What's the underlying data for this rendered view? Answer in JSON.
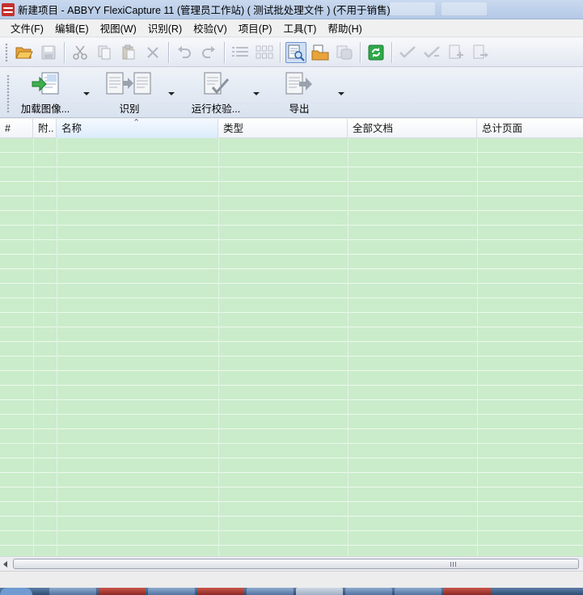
{
  "window": {
    "title": "新建项目 - ABBYY FlexiCapture 11 (管理员工作站) ( 测试批处理文件 ) (不用于销售)"
  },
  "menu": [
    {
      "name": "menu-file",
      "label": "文件(F)"
    },
    {
      "name": "menu-edit",
      "label": "编辑(E)"
    },
    {
      "name": "menu-view",
      "label": "视图(W)"
    },
    {
      "name": "menu-recognize",
      "label": "识别(R)"
    },
    {
      "name": "menu-verify",
      "label": "校验(V)"
    },
    {
      "name": "menu-project",
      "label": "项目(P)"
    },
    {
      "name": "menu-tools",
      "label": "工具(T)"
    },
    {
      "name": "menu-help",
      "label": "帮助(H)"
    }
  ],
  "big_toolbar": {
    "load_images": "加载图像...",
    "recognize": "识别",
    "run_verification": "运行校验...",
    "export": "导出"
  },
  "grid": {
    "columns": [
      "#",
      "附..",
      "名称",
      "类型",
      "全部文档",
      "总计页面"
    ],
    "rows": []
  },
  "colors": {
    "grid_background": "#caeccb",
    "title_bar": "#b4c9e6"
  }
}
